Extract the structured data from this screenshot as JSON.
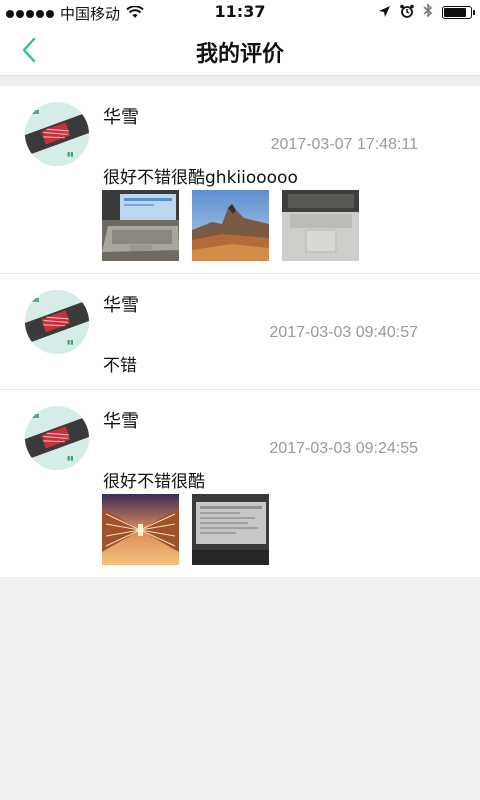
{
  "status_bar": {
    "carrier": "中国移动",
    "time": "11:37",
    "battery_level": 0.85
  },
  "nav": {
    "title": "我的评价"
  },
  "reviews": [
    {
      "user": "华雪",
      "time": "2017-03-07 17:48:11",
      "text": "很好不错很酷ghkiiooooo",
      "photos": [
        "laptop-screen-photo",
        "mountain-landscape-photo",
        "laptop-keyboard-photo"
      ]
    },
    {
      "user": "华雪",
      "time": "2017-03-03 09:40:57",
      "text": "不错",
      "photos": []
    },
    {
      "user": "华雪",
      "time": "2017-03-03 09:24:55",
      "text": "很好不错很酷",
      "photos": [
        "symmetric-architecture-photo",
        "monitor-photo"
      ]
    }
  ],
  "colors": {
    "accent": "#2bbf9b",
    "timestamp": "#9a9a9a",
    "background": "#efefef"
  }
}
